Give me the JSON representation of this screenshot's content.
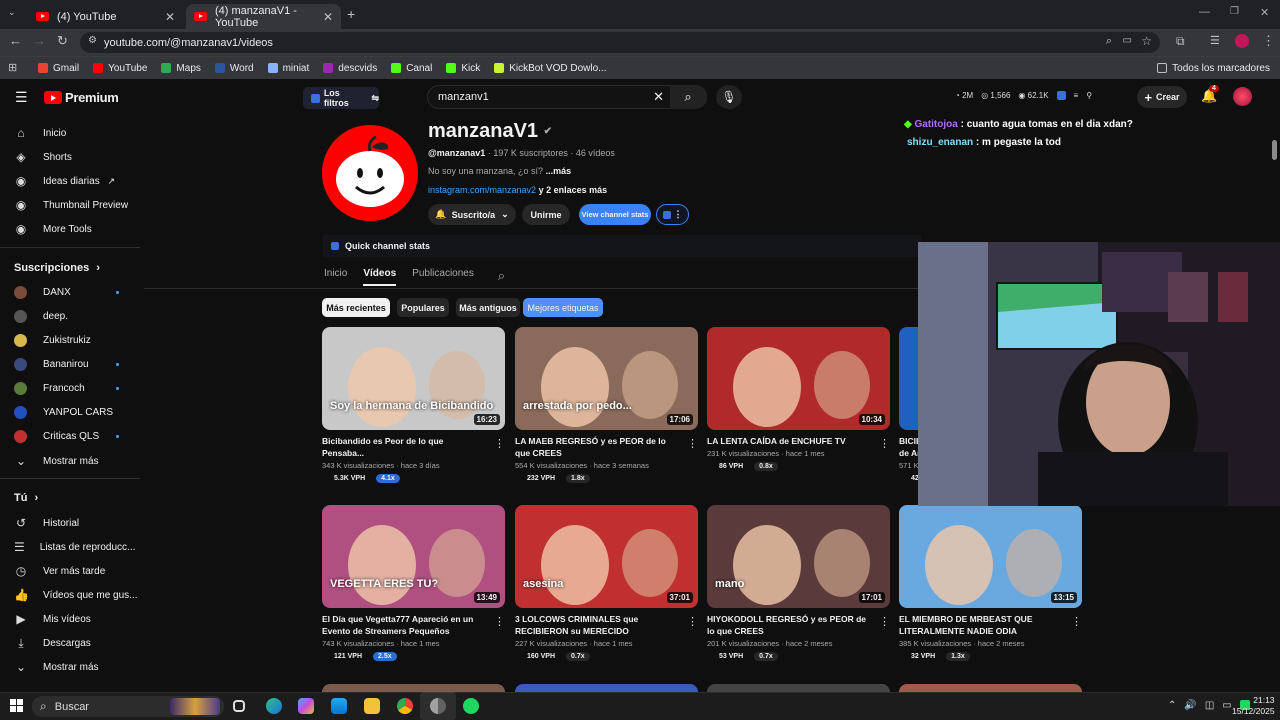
{
  "browser": {
    "tabs": [
      {
        "title": "(4) YouTube"
      },
      {
        "title": "(4) manzanaV1 - YouTube"
      }
    ],
    "url": "youtube.com/@manzanav1/videos",
    "bookmarks": [
      "Gmail",
      "YouTube",
      "Maps",
      "Word",
      "miniat",
      "descvids",
      "Canal",
      "Kick",
      "KickBot VOD Dowlo..."
    ],
    "all_bookmarks": "Todos los marcadores"
  },
  "header": {
    "logo": "Premium",
    "filters": "Los filtros",
    "search_value": "manzanv1",
    "create": "Crear",
    "notif_count": "4",
    "stats": [
      "2M",
      "1,566",
      "62.1K"
    ]
  },
  "sidebar": {
    "main": [
      {
        "label": "Inicio",
        "icon": "home-icon"
      },
      {
        "label": "Shorts",
        "icon": "shorts-icon"
      },
      {
        "label": "Ideas diarias",
        "icon": "ideas-icon"
      },
      {
        "label": "Thumbnail Preview",
        "icon": "thumbnail-icon"
      },
      {
        "label": "More Tools",
        "icon": "tools-icon"
      }
    ],
    "subs_title": "Suscripciones",
    "subs": [
      {
        "label": "DANX",
        "color": "#7a4a3a"
      },
      {
        "label": "deep.",
        "color": "#444"
      },
      {
        "label": "Zukistrukiz",
        "color": "#d9b84a"
      },
      {
        "label": "Bananirou",
        "color": "#3a4a7a"
      },
      {
        "label": "Francoch",
        "color": "#5a7a3a"
      },
      {
        "label": "YANPOL CARS",
        "color": "#2050c0"
      },
      {
        "label": "Criticas QLS",
        "color": "#c03030"
      }
    ],
    "show_more": "Mostrar más",
    "you_title": "Tú",
    "you": [
      {
        "label": "Historial",
        "icon": "history-icon"
      },
      {
        "label": "Listas de reproducc...",
        "icon": "playlist-icon"
      },
      {
        "label": "Ver más tarde",
        "icon": "clock-icon"
      },
      {
        "label": "Vídeos que me gus...",
        "icon": "like-icon"
      },
      {
        "label": "Mis vídeos",
        "icon": "myvideos-icon"
      },
      {
        "label": "Descargas",
        "icon": "download-icon"
      }
    ],
    "show_more2": "Mostrar más"
  },
  "channel": {
    "name": "manzanaV1",
    "handle": "@manzanav1",
    "subs": "197 K suscriptores",
    "videos": "46 vídeos",
    "desc": "No soy una manzana, ¿o sí?",
    "desc_more": "...más",
    "link": "instagram.com/manzanav2",
    "link_more": "y 2 enlaces más",
    "subscribed": "Suscrito/a",
    "join": "Unirme",
    "view_stats": "View channel stats",
    "quick_stats": "Quick channel stats",
    "tabs": [
      "Inicio",
      "Vídeos",
      "Publicaciones"
    ],
    "chips": [
      "Más recientes",
      "Populares",
      "Más antiguos",
      "Mejores etiquetas"
    ]
  },
  "videos": [
    {
      "title": "Bicibandido es Peor de lo que Pensaba...",
      "meta": "343 K visualizaciones · hace 3 días",
      "duration": "16:23",
      "vph": "5.3K VPH",
      "ratio": "4.1x",
      "hot": true,
      "bg": "#c8c8c8",
      "overlay": "Soy la hermana de Bicibandido"
    },
    {
      "title": "LA MAEB REGRESÓ y es PEOR de lo que CREES",
      "meta": "554 K visualizaciones · hace 3 semanas",
      "duration": "17:06",
      "vph": "232 VPH",
      "ratio": "1.8x",
      "hot": false,
      "bg": "#8a6a5a",
      "overlay": "arrestada por pedo..."
    },
    {
      "title": "LA LENTA CAÍDA de ENCHUFE TV",
      "meta": "231 K visualizaciones · hace 1 mes",
      "duration": "10:34",
      "vph": "86 VPH",
      "ratio": "0.8x",
      "hot": false,
      "bg": "#b02a2a",
      "overlay": ""
    },
    {
      "title": "BICIBANDIDO: El YouTuber Más Odiado de Argentina",
      "meta": "571 K visualizaciones · hace 1 mes",
      "duration": "",
      "vph": "425 VPH",
      "ratio": "1.9x",
      "hot": false,
      "bg": "#2060c0",
      "overlay": ""
    },
    {
      "title": "El Día que Vegetta777 Apareció en un Evento de Streamers Pequeños",
      "meta": "743 K visualizaciones · hace 1 mes",
      "duration": "13:49",
      "vph": "121 VPH",
      "ratio": "2.5x",
      "hot": true,
      "bg": "#b05080",
      "overlay": "VEGETTA ERES TU?"
    },
    {
      "title": "3 LOLCOWS CRIMINALES que RECIBIERON su MERECIDO",
      "meta": "227 K visualizaciones · hace 1 mes",
      "duration": "37:01",
      "vph": "160 VPH",
      "ratio": "0.7x",
      "hot": false,
      "bg": "#c03030",
      "overlay": "asesina"
    },
    {
      "title": "HIYOKODOLL REGRESÓ y es PEOR de lo que CREES",
      "meta": "201 K visualizaciones · hace 2 meses",
      "duration": "17:01",
      "vph": "53 VPH",
      "ratio": "0.7x",
      "hot": false,
      "bg": "#5a3a3a",
      "overlay": "mano"
    },
    {
      "title": "EL MIEMBRO DE MRBEAST QUE LITERALMENTE NADIE ODIA",
      "meta": "385 K visualizaciones · hace 2 meses",
      "duration": "13:15",
      "vph": "32 VPH",
      "ratio": "1.3x",
      "hot": false,
      "bg": "#6aa8e0",
      "overlay": ""
    }
  ],
  "chat": [
    {
      "user": "Gatitojoa",
      "msg": "cuanto agua tomas en el dia xdan?",
      "color": "#b36bff"
    },
    {
      "user": "shizu_enanan",
      "msg": "m pegaste la tod",
      "color": "#7fe0ff"
    }
  ],
  "taskbar": {
    "search": "Buscar",
    "time": "21:13",
    "date": "15/12/2025"
  }
}
